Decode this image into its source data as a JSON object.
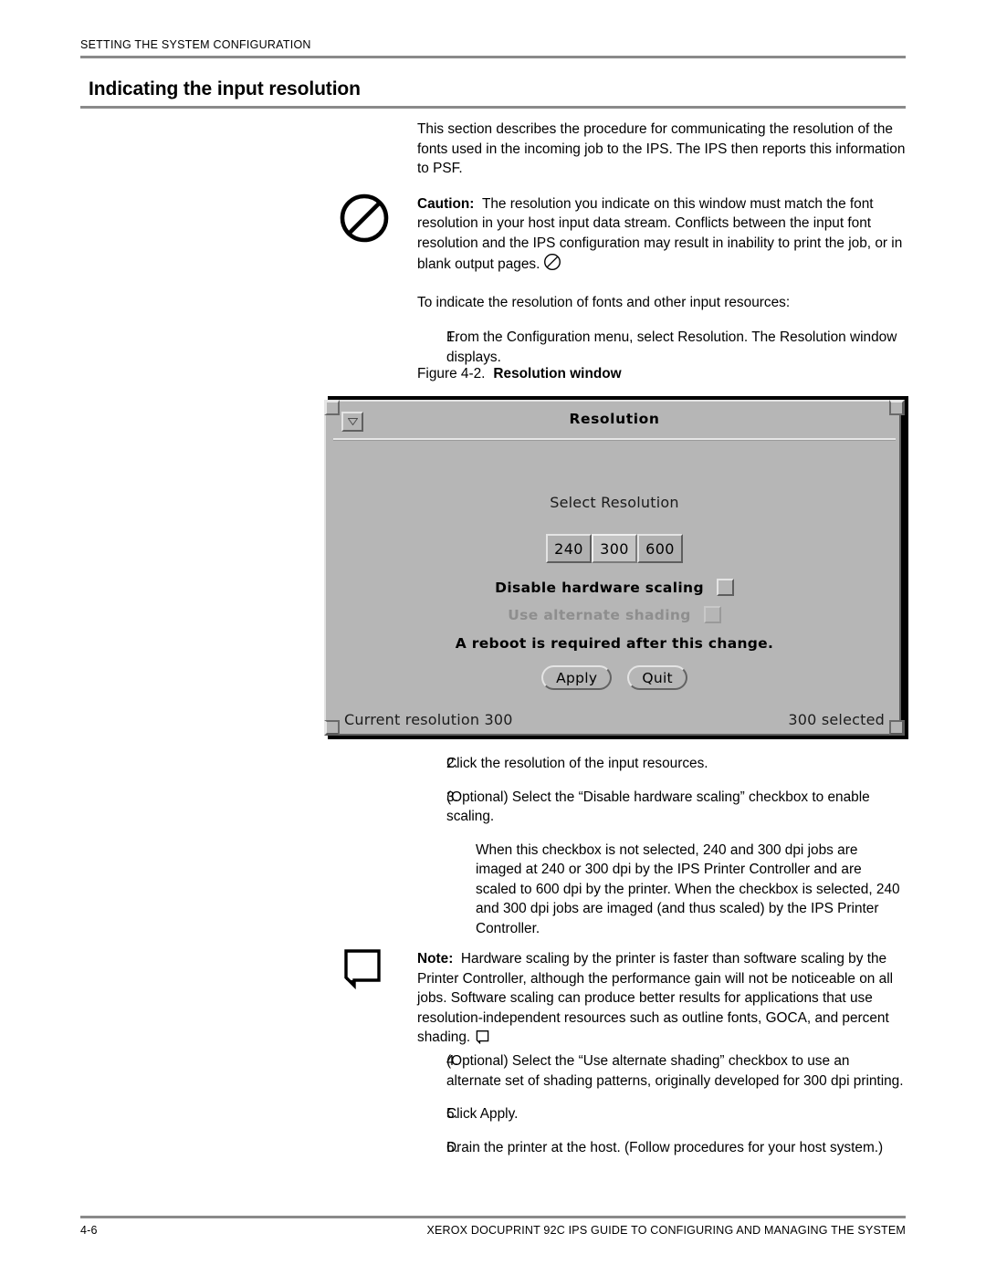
{
  "header": {
    "running_title": "SETTING THE SYSTEM CONFIGURATION"
  },
  "section": {
    "title": "Indicating the input resolution"
  },
  "body": {
    "intro": "This section describes the procedure for communicating the resolution of the fonts used in the incoming job to the IPS. The IPS then reports this information to PSF.",
    "caution_label": "Caution:",
    "caution_text": "The resolution you indicate on this window must match the font resolution in your host input data stream. Conflicts between the input font resolution and the IPS configuration may result in inability to print the job, or in blank output pages.",
    "to_indicate": "To indicate the resolution of fonts and other input resources:",
    "note_label": "Note:",
    "note_text": "Hardware scaling by the printer is faster than software scaling by the Printer Controller, although the performance gain will not be noticeable on all jobs. Software scaling can produce better results for applications that use resolution-independent resources such as outline fonts, GOCA, and percent shading."
  },
  "steps": [
    {
      "num": "1.",
      "text": "From the Configuration menu, select Resolution. The Resolution window displays."
    },
    {
      "num": "2.",
      "text": "Click the resolution of the input resources."
    },
    {
      "num": "3.",
      "text": "(Optional) Select the “Disable hardware scaling” checkbox to enable scaling."
    },
    {
      "num": "4.",
      "text": "(Optional) Select the “Use alternate shading” checkbox to use an alternate set of shading patterns, originally developed for 300 dpi printing."
    },
    {
      "num": "5.",
      "text": "Click Apply."
    },
    {
      "num": "6.",
      "text": "Drain the printer at the host. (Follow procedures for your host system.)"
    }
  ],
  "step3_detail": "When this checkbox is not selected, 240 and 300 dpi jobs are imaged at 240 or 300 dpi by the IPS Printer Controller and are scaled to 600 dpi by the printer. When the checkbox is selected, 240 and 300 dpi jobs are imaged (and thus scaled) by the IPS Printer Controller.",
  "figure": {
    "label": "Figure 4-2.",
    "title": "Resolution window"
  },
  "dialog": {
    "title": "Resolution",
    "window_menu_icon": "triangle-down-icon",
    "select_label": "Select Resolution",
    "resolution_options": [
      {
        "value": "240",
        "selected": false
      },
      {
        "value": "300",
        "selected": true
      },
      {
        "value": "600",
        "selected": false
      }
    ],
    "checkboxes": [
      {
        "label": "Disable hardware scaling",
        "checked": false,
        "disabled": false
      },
      {
        "label": "Use alternate shading",
        "checked": false,
        "disabled": true
      }
    ],
    "reboot_message": "A reboot is required after this change.",
    "buttons": [
      {
        "label": "Apply"
      },
      {
        "label": "Quit"
      }
    ],
    "status_left": "Current resolution 300",
    "status_right": "300 selected"
  },
  "footer": {
    "page_number": "4-6",
    "book_title": "XEROX DOCUPRINT 92C IPS GUIDE TO CONFIGURING AND MANAGING THE SYSTEM"
  },
  "colors": {
    "rule": "#8a8a8a",
    "dialog_face": "#b6b6b6",
    "dialog_selected": "#c3c3c3",
    "text": "#000000",
    "disabled_text": "#8e8e8e"
  }
}
